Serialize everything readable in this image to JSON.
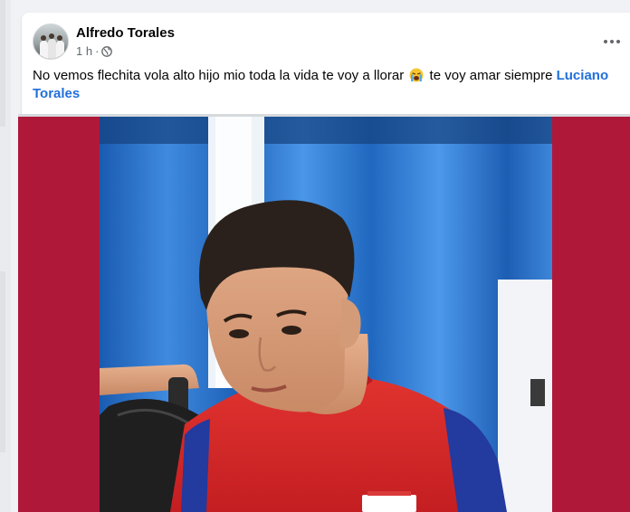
{
  "post": {
    "author": "Alfredo Torales",
    "time": "1 h",
    "separator": "·",
    "privacy_icon": "globe-icon",
    "more_icon": "more-options-icon",
    "text_before_emoji": "No vemos flechita vola alto hijo mio toda la vida te voy a llorar",
    "emoji_icon": "crying-face-emoji",
    "text_after_emoji": "te voy amar siempre",
    "mention": "Luciano Torales"
  },
  "media": {
    "background_color": "#b0183a",
    "photo_subject": "photo"
  },
  "colors": {
    "link": "#216fdb",
    "secondary_text": "#65676b"
  }
}
